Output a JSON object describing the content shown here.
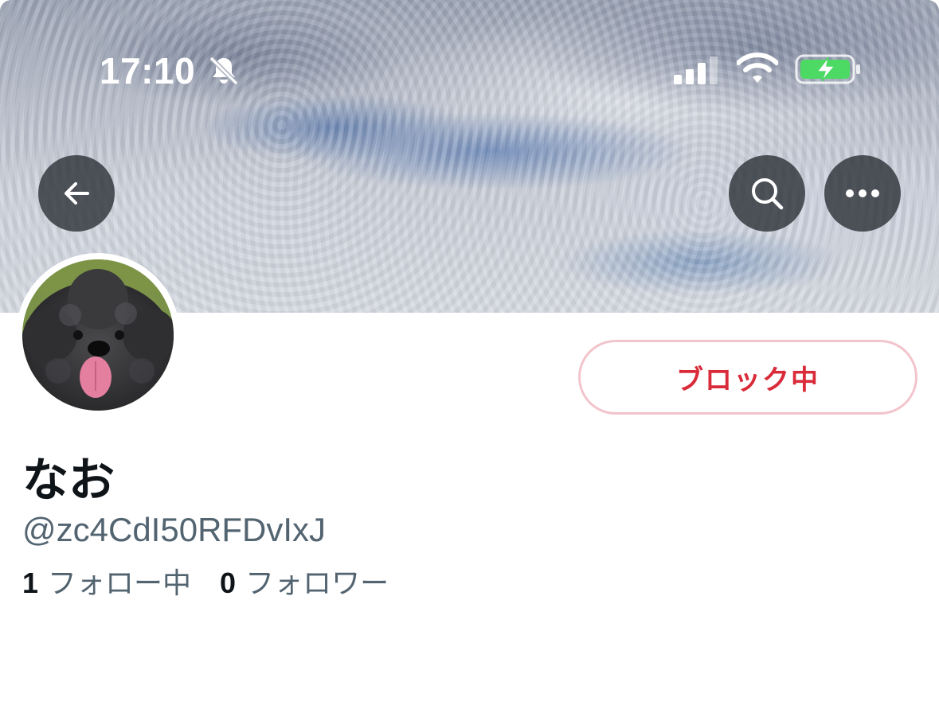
{
  "status_bar": {
    "time": "17:10",
    "icons": [
      "mute-icon",
      "signal-icon",
      "wifi-icon",
      "battery-charging-icon"
    ]
  },
  "header": {
    "icons": [
      "back-arrow-icon",
      "search-icon",
      "more-icon"
    ]
  },
  "profile": {
    "display_name": "なお",
    "handle": "@zc4CdI50RFDvIxJ",
    "block_button_label": "ブロック中",
    "following_count": "1",
    "following_label": "フォロー中",
    "followers_count": "0",
    "followers_label": "フォロワー"
  },
  "colors": {
    "block_red": "#d92b3a",
    "block_border": "#f2c4cc",
    "text_primary": "#0f1419",
    "text_secondary": "#536471",
    "battery_green": "#4cd964"
  }
}
